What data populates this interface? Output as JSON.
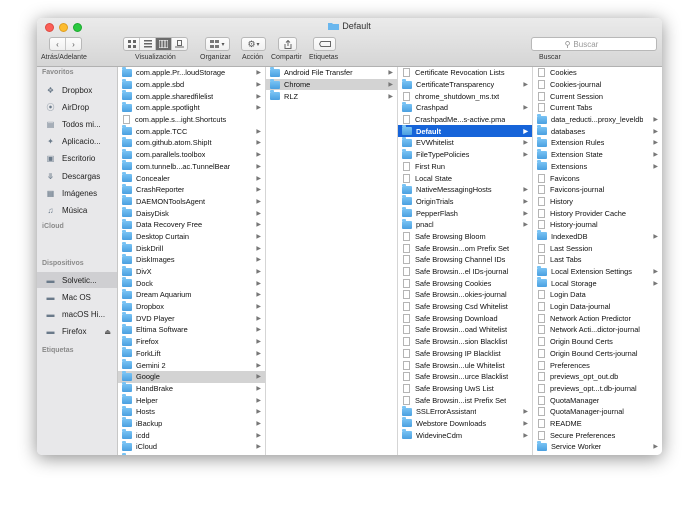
{
  "window": {
    "title": "Default"
  },
  "toolbar": {
    "nav_label": "Atrás/Adelante",
    "view_label": "Visualización",
    "arrange_label": "Organizar",
    "action_label": "Acción",
    "share_label": "Compartir",
    "tags_label": "Etiquetas",
    "search_placeholder": "Buscar",
    "search_label": "Buscar"
  },
  "sidebar": {
    "favorites_header": "Favoritos",
    "favorites": [
      {
        "label": "Dropbox",
        "icon": "dropbox-icon"
      },
      {
        "label": "AirDrop",
        "icon": "airdrop-icon"
      },
      {
        "label": "Todos mi...",
        "icon": "all-files-icon"
      },
      {
        "label": "Aplicacio...",
        "icon": "applications-icon"
      },
      {
        "label": "Escritorio",
        "icon": "desktop-icon"
      },
      {
        "label": "Descargas",
        "icon": "downloads-icon"
      },
      {
        "label": "Imágenes",
        "icon": "pictures-icon"
      },
      {
        "label": "Música",
        "icon": "music-icon"
      }
    ],
    "icloud_header": "iCloud",
    "devices_header": "Dispositivos",
    "devices": [
      {
        "label": "Solvetic...",
        "icon": "disk-icon",
        "selected": true
      },
      {
        "label": "Mac OS",
        "icon": "disk-icon"
      },
      {
        "label": "macOS Hi...",
        "icon": "disk-icon"
      },
      {
        "label": "Firefox",
        "icon": "disk-icon",
        "eject": true
      }
    ],
    "tags_header": "Etiquetas"
  },
  "columns": [
    {
      "items": [
        {
          "name": "com.apple.Pr...loudStorage",
          "type": "folder"
        },
        {
          "name": "com.apple.sbd",
          "type": "folder"
        },
        {
          "name": "com.apple.sharedfilelist",
          "type": "folder"
        },
        {
          "name": "com.apple.spotlight",
          "type": "folder"
        },
        {
          "name": "com.apple.s...ight.Shortcuts",
          "type": "file"
        },
        {
          "name": "com.apple.TCC",
          "type": "folder"
        },
        {
          "name": "com.github.atom.ShipIt",
          "type": "folder"
        },
        {
          "name": "com.parallels.toolbox",
          "type": "folder"
        },
        {
          "name": "com.tunnelb...ac.TunnelBear",
          "type": "folder"
        },
        {
          "name": "Concealer",
          "type": "folder"
        },
        {
          "name": "CrashReporter",
          "type": "folder"
        },
        {
          "name": "DAEMONToolsAgent",
          "type": "folder"
        },
        {
          "name": "DaisyDisk",
          "type": "folder"
        },
        {
          "name": "Data Recovery Free",
          "type": "folder"
        },
        {
          "name": "Desktop Curtain",
          "type": "folder"
        },
        {
          "name": "DiskDrill",
          "type": "folder"
        },
        {
          "name": "DiskImages",
          "type": "folder"
        },
        {
          "name": "DivX",
          "type": "folder"
        },
        {
          "name": "Dock",
          "type": "folder"
        },
        {
          "name": "Dream Aquarium",
          "type": "folder"
        },
        {
          "name": "Dropbox",
          "type": "folder"
        },
        {
          "name": "DVD Player",
          "type": "folder"
        },
        {
          "name": "Eltima Software",
          "type": "folder"
        },
        {
          "name": "Firefox",
          "type": "folder"
        },
        {
          "name": "ForkLift",
          "type": "folder"
        },
        {
          "name": "Gemini 2",
          "type": "folder"
        },
        {
          "name": "Google",
          "type": "folder",
          "selected": true
        },
        {
          "name": "HandBrake",
          "type": "folder"
        },
        {
          "name": "Helper",
          "type": "folder"
        },
        {
          "name": "Hosts",
          "type": "folder"
        },
        {
          "name": "iBackup",
          "type": "folder"
        },
        {
          "name": "icdd",
          "type": "folder"
        },
        {
          "name": "iCloud",
          "type": "folder"
        },
        {
          "name": "iGetter",
          "type": "folder"
        }
      ]
    },
    {
      "items": [
        {
          "name": "Android File Transfer",
          "type": "folder"
        },
        {
          "name": "Chrome",
          "type": "folder",
          "selected": true
        },
        {
          "name": "RLZ",
          "type": "folder"
        }
      ]
    },
    {
      "items": [
        {
          "name": "Certificate Revocation Lists",
          "type": "file"
        },
        {
          "name": "CertificateTransparency",
          "type": "folder"
        },
        {
          "name": "chrome_shutdown_ms.txt",
          "type": "file"
        },
        {
          "name": "Crashpad",
          "type": "folder"
        },
        {
          "name": "CrashpadMe...s-active.pma",
          "type": "file"
        },
        {
          "name": "Default",
          "type": "folder",
          "active": true
        },
        {
          "name": "EVWhitelist",
          "type": "folder"
        },
        {
          "name": "FileTypePolicies",
          "type": "folder"
        },
        {
          "name": "First Run",
          "type": "file"
        },
        {
          "name": "Local State",
          "type": "file"
        },
        {
          "name": "NativeMessagingHosts",
          "type": "folder"
        },
        {
          "name": "OriginTrials",
          "type": "folder"
        },
        {
          "name": "PepperFlash",
          "type": "folder"
        },
        {
          "name": "pnacl",
          "type": "folder"
        },
        {
          "name": "Safe Browsing Bloom",
          "type": "file"
        },
        {
          "name": "Safe Browsin...om Prefix Set",
          "type": "file"
        },
        {
          "name": "Safe Browsing Channel IDs",
          "type": "file"
        },
        {
          "name": "Safe Browsin...el IDs-journal",
          "type": "file"
        },
        {
          "name": "Safe Browsing Cookies",
          "type": "file"
        },
        {
          "name": "Safe Browsin...okies-journal",
          "type": "file"
        },
        {
          "name": "Safe Browsing Csd Whitelist",
          "type": "file"
        },
        {
          "name": "Safe Browsing Download",
          "type": "file"
        },
        {
          "name": "Safe Browsin...oad Whitelist",
          "type": "file"
        },
        {
          "name": "Safe Browsin...sion Blacklist",
          "type": "file"
        },
        {
          "name": "Safe Browsing IP Blacklist",
          "type": "file"
        },
        {
          "name": "Safe Browsin...ule Whitelist",
          "type": "file"
        },
        {
          "name": "Safe Browsin...urce Blacklist",
          "type": "file"
        },
        {
          "name": "Safe Browsing UwS List",
          "type": "file"
        },
        {
          "name": "Safe Browsin...ist Prefix Set",
          "type": "file"
        },
        {
          "name": "SSLErrorAssistant",
          "type": "folder"
        },
        {
          "name": "Webstore Downloads",
          "type": "folder"
        },
        {
          "name": "WidevineCdm",
          "type": "folder"
        }
      ]
    },
    {
      "items": [
        {
          "name": "Cookies",
          "type": "file"
        },
        {
          "name": "Cookies-journal",
          "type": "file"
        },
        {
          "name": "Current Session",
          "type": "file"
        },
        {
          "name": "Current Tabs",
          "type": "file"
        },
        {
          "name": "data_reducti...proxy_leveldb",
          "type": "folder"
        },
        {
          "name": "databases",
          "type": "folder"
        },
        {
          "name": "Extension Rules",
          "type": "folder"
        },
        {
          "name": "Extension State",
          "type": "folder"
        },
        {
          "name": "Extensions",
          "type": "folder"
        },
        {
          "name": "Favicons",
          "type": "file"
        },
        {
          "name": "Favicons-journal",
          "type": "file"
        },
        {
          "name": "History",
          "type": "file"
        },
        {
          "name": "History Provider Cache",
          "type": "file"
        },
        {
          "name": "History-journal",
          "type": "file"
        },
        {
          "name": "IndexedDB",
          "type": "folder"
        },
        {
          "name": "Last Session",
          "type": "file"
        },
        {
          "name": "Last Tabs",
          "type": "file"
        },
        {
          "name": "Local Extension Settings",
          "type": "folder"
        },
        {
          "name": "Local Storage",
          "type": "folder"
        },
        {
          "name": "Login Data",
          "type": "file"
        },
        {
          "name": "Login Data-journal",
          "type": "file"
        },
        {
          "name": "Network Action Predictor",
          "type": "file"
        },
        {
          "name": "Network Acti...dictor-journal",
          "type": "file"
        },
        {
          "name": "Origin Bound Certs",
          "type": "file"
        },
        {
          "name": "Origin Bound Certs-journal",
          "type": "file"
        },
        {
          "name": "Preferences",
          "type": "file"
        },
        {
          "name": "previews_opt_out.db",
          "type": "file"
        },
        {
          "name": "previews_opt...t.db-journal",
          "type": "file"
        },
        {
          "name": "QuotaManager",
          "type": "file"
        },
        {
          "name": "QuotaManager-journal",
          "type": "file"
        },
        {
          "name": "README",
          "type": "file"
        },
        {
          "name": "Secure Preferences",
          "type": "file"
        },
        {
          "name": "Service Worker",
          "type": "folder"
        }
      ]
    }
  ]
}
